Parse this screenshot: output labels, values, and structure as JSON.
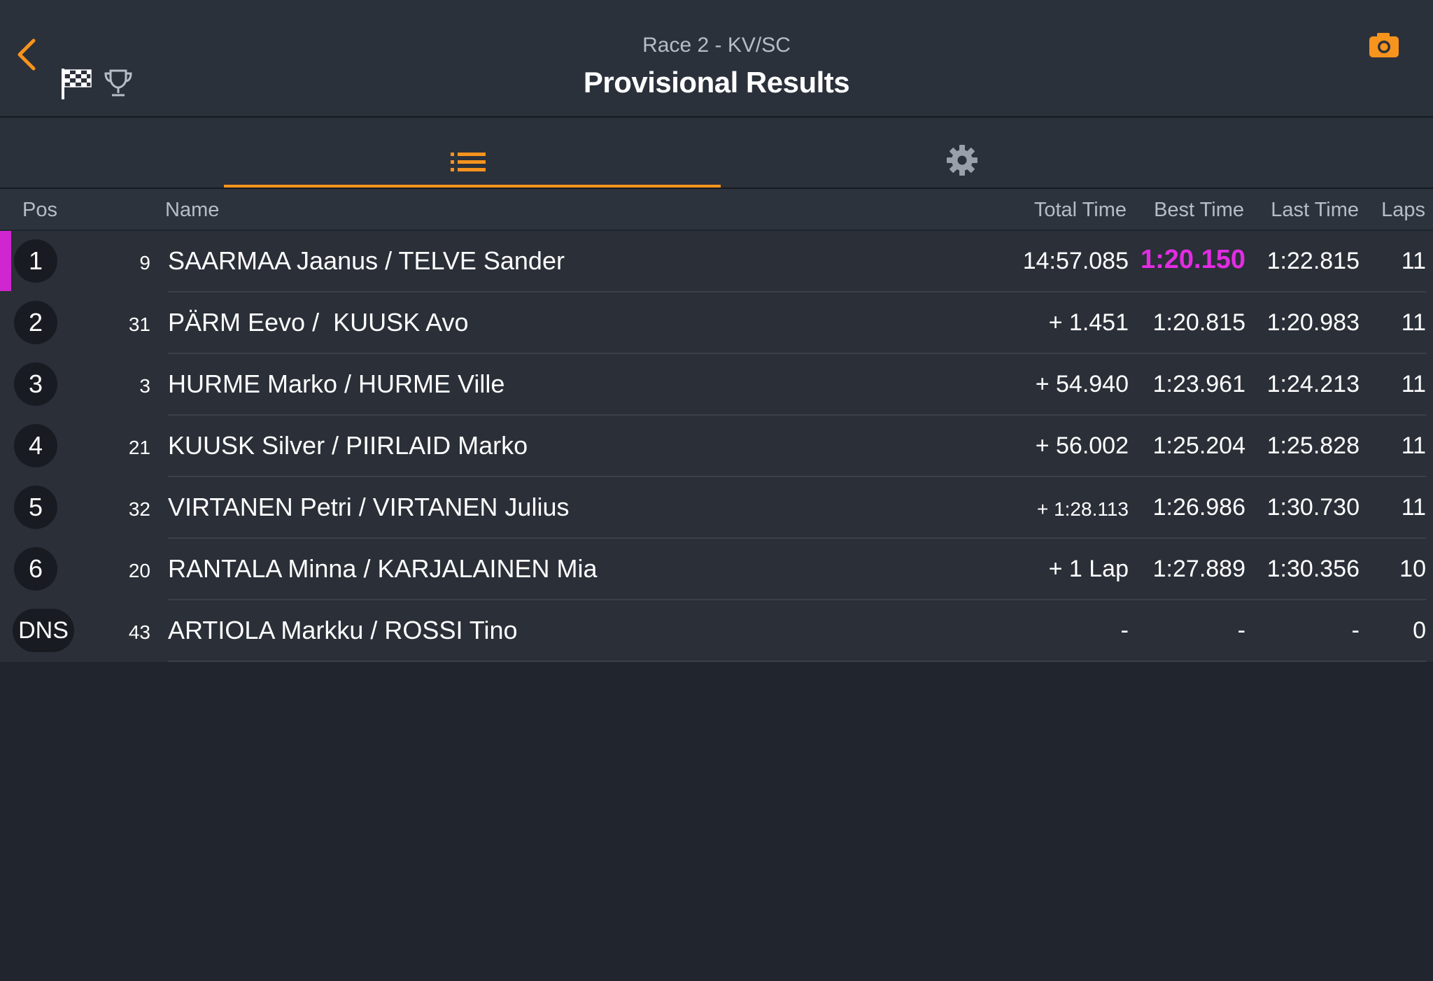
{
  "header": {
    "subtitle": "Race 2 - KV/SC",
    "title": "Provisional Results",
    "icons": {
      "back": "chevron-left-icon",
      "flag": "checkered-flag-icon",
      "trophy": "trophy-icon",
      "camera": "camera-icon"
    },
    "accent_color": "#f7941d"
  },
  "tabs": [
    {
      "icon": "list-icon",
      "active": true
    },
    {
      "icon": "gear-icon",
      "active": false
    }
  ],
  "columns": {
    "pos": "Pos",
    "name": "Name",
    "total": "Total Time",
    "best": "Best Time",
    "last": "Last Time",
    "laps": "Laps"
  },
  "fastest_lap_color": "#e22ce2",
  "rows": [
    {
      "pos": "1",
      "number": "9",
      "name": "SAARMAA Jaanus / TELVE Sander",
      "total": "14:57.085",
      "best": "1:20.150",
      "last": "1:22.815",
      "laps": "11"
    },
    {
      "pos": "2",
      "number": "31",
      "name": "PÄRM Eevo /  KUUSK Avo",
      "total": "+ 1.451",
      "best": "1:20.815",
      "last": "1:20.983",
      "laps": "11"
    },
    {
      "pos": "3",
      "number": "3",
      "name": "HURME Marko / HURME Ville",
      "total": "+ 54.940",
      "best": "1:23.961",
      "last": "1:24.213",
      "laps": "11"
    },
    {
      "pos": "4",
      "number": "21",
      "name": "KUUSK Silver / PIIRLAID Marko",
      "total": "+ 56.002",
      "best": "1:25.204",
      "last": "1:25.828",
      "laps": "11"
    },
    {
      "pos": "5",
      "number": "32",
      "name": "VIRTANEN Petri / VIRTANEN Julius",
      "total": "+ 1:28.113",
      "best": "1:26.986",
      "last": "1:30.730",
      "laps": "11"
    },
    {
      "pos": "6",
      "number": "20",
      "name": "RANTALA Minna / KARJALAINEN Mia",
      "total": "+ 1 Lap",
      "best": "1:27.889",
      "last": "1:30.356",
      "laps": "10"
    },
    {
      "pos": "DNS",
      "number": "43",
      "name": "ARTIOLA Markku / ROSSI Tino",
      "total": "-",
      "best": "-",
      "last": "-",
      "laps": "0"
    }
  ]
}
